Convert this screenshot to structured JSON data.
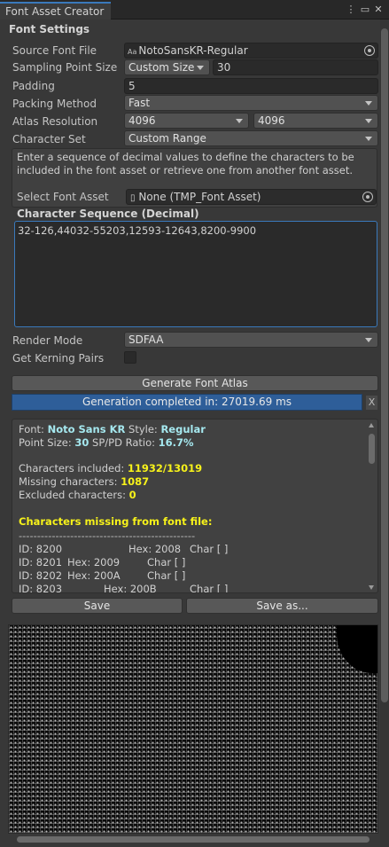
{
  "window": {
    "tab_title": "Font Asset Creator",
    "menu_icon": "kebab-menu-icon",
    "maximize_icon": "maximize-icon",
    "close_icon": "close-icon"
  },
  "settings": {
    "section_title": "Font Settings",
    "source_font_file": {
      "label": "Source Font File",
      "value": "NotoSansKR-Regular",
      "icon": "font-asset-icon",
      "icon_text": "Aa"
    },
    "sampling_point_size": {
      "label": "Sampling Point Size",
      "mode": "Custom Size",
      "value": "30"
    },
    "padding": {
      "label": "Padding",
      "value": "5"
    },
    "packing_method": {
      "label": "Packing Method",
      "value": "Fast"
    },
    "atlas_resolution": {
      "label": "Atlas Resolution",
      "width": "4096",
      "height": "4096"
    },
    "character_set": {
      "label": "Character Set",
      "value": "Custom Range"
    },
    "help_text": "Enter a sequence of decimal values to define the characters to be included in the font asset or retrieve one from another font asset.",
    "select_font_asset": {
      "label": "Select Font Asset",
      "value": "None (TMP_Font Asset)",
      "icon": "document-icon"
    },
    "character_sequence": {
      "label": "Character Sequence (Decimal)",
      "value": "32-126,44032-55203,12593-12643,8200-9900"
    },
    "render_mode": {
      "label": "Render Mode",
      "value": "SDFAA"
    },
    "get_kerning_pairs": {
      "label": "Get Kerning Pairs",
      "checked": false
    }
  },
  "actions": {
    "generate_label": "Generate Font Atlas",
    "progress_text": "Generation completed in: 27019.69 ms",
    "progress_value": 1.0,
    "cancel_label": "X",
    "save_label": "Save",
    "save_as_label": "Save as..."
  },
  "output": {
    "font_prefix": "Font: ",
    "font_name": "Noto Sans KR",
    "style_prefix": "  Style: ",
    "style_name": "Regular",
    "point_size_prefix": "Point Size: ",
    "point_size": "30",
    "ratio_prefix": "  SP/PD Ratio: ",
    "ratio": "16.7%",
    "included_prefix": "Characters included: ",
    "included": "11932/13019",
    "missing_prefix": "Missing characters: ",
    "missing": "1087",
    "excluded_prefix": "Excluded characters: ",
    "excluded": "0",
    "missing_header": "Characters missing from font file:",
    "separator": "------------------------------------------------",
    "rows": [
      {
        "id": "ID: 8200",
        "hex": "Hex: 2008",
        "char": "Char [ ]"
      },
      {
        "id": "ID: 8201",
        "hex": "Hex: 2009",
        "char": "Char [ ]"
      },
      {
        "id": "ID: 8202",
        "hex": "Hex: 200A",
        "char": "Char [ ]"
      },
      {
        "id": "ID: 8203",
        "hex": "Hex: 200B",
        "char": "Char [ ]"
      }
    ]
  },
  "colors": {
    "accent": "#3a79bb",
    "progress": "#2e5e99",
    "highlight_cyan": "#a5e8ef",
    "highlight_yellow": "#f7f21a"
  }
}
